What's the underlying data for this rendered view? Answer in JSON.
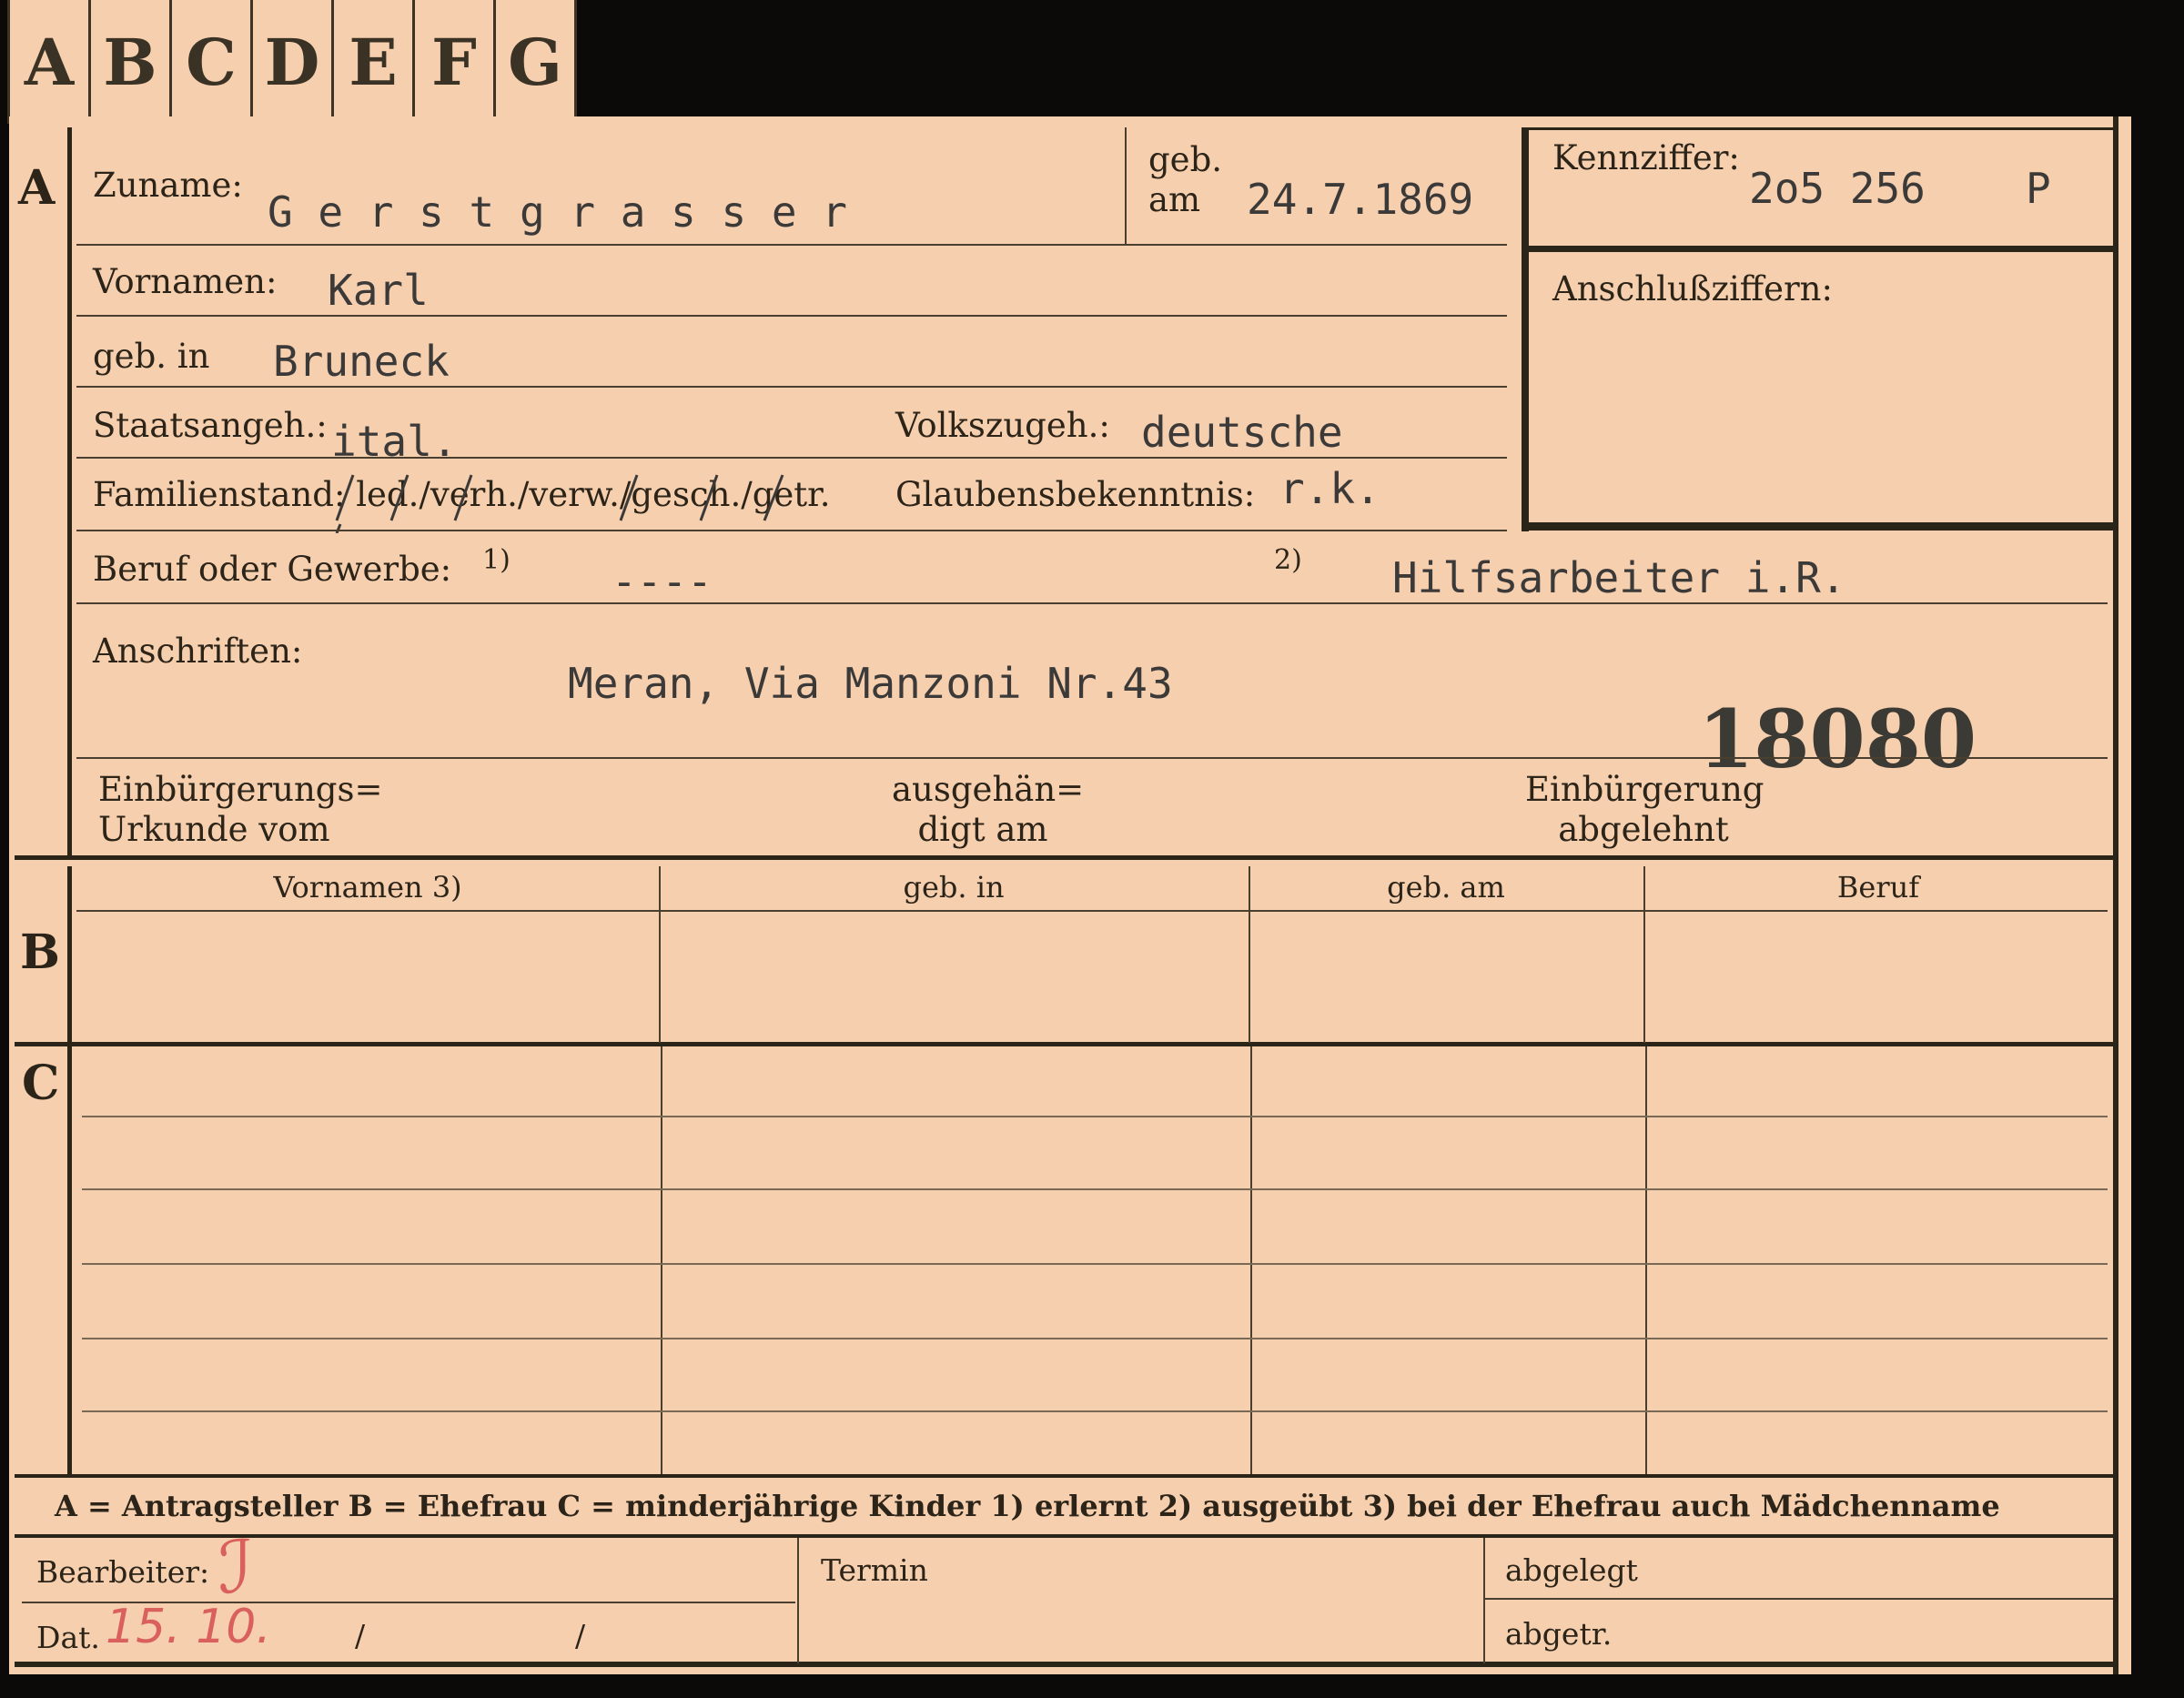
{
  "tabs": [
    "A",
    "B",
    "C",
    "D",
    "E",
    "F",
    "G"
  ],
  "section_a": {
    "marker": "A",
    "surname_label": "Zuname:",
    "surname_value": "G e r s t g r a s s e r",
    "born_on_label": "geb. am",
    "born_on_value": "24.7.1869",
    "first_names_label": "Vornamen:",
    "first_names_value": "Karl",
    "born_in_label": "geb. in",
    "born_in_value": "Bruneck",
    "citizenship_label": "Staatsangeh.:",
    "citizenship_value": "ital.",
    "ethnicity_label": "Volkszugeh.:",
    "ethnicity_value": "deutsche",
    "marital_label": "Familienstand: led./verh./verw./gesch./getr.",
    "religion_label": "Glaubensbekenntnis:",
    "religion_value": "r.k.",
    "occupation_label": "Beruf oder Gewerbe:",
    "occupation_ref1": "1)",
    "occupation_value1": "----",
    "occupation_ref2": "2)",
    "occupation_value2": "Hilfsarbeiter i.R.",
    "address_label": "Anschriften:",
    "address_value": "Meran, Via Manzoni Nr.43",
    "stamp_number": "18080",
    "naturalization_cert_label": "Einbürgerungs= Urkunde vom",
    "handed_out_label": "ausgehän= digt am",
    "naturalization_denied_label": "Einbürgerung abgelehnt",
    "id_label": "Kennziffer:",
    "id_value": "2o5 256",
    "id_suffix": "P",
    "linked_label": "Anschlußziffern:"
  },
  "section_b": {
    "marker": "B",
    "columns": [
      "Vornamen 3)",
      "geb. in",
      "geb. am",
      "Beruf"
    ]
  },
  "section_c": {
    "marker": "C"
  },
  "legend": "A = Antragsteller   B = Ehefrau   C = minderjährige Kinder   1) erlernt   2) ausgeübt   3) bei der Ehefrau auch Mädchenname",
  "footer": {
    "clerk_label": "Bearbeiter:",
    "date_label": "Dat.",
    "date_value": "15. 10.",
    "slash": "/",
    "deadline_label": "Termin",
    "filed_label": "abgelegt",
    "removed_label": "abgetr."
  },
  "colors": {
    "card": "#f6cfae",
    "ink": "#2c2418",
    "red_pencil": "#d9605c",
    "background": "#0b0a08"
  }
}
